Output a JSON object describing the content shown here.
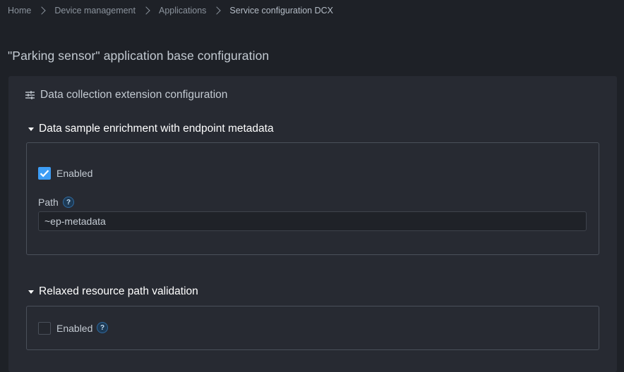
{
  "breadcrumb": {
    "items": [
      "Home",
      "Device management",
      "Applications",
      "Service configuration DCX"
    ]
  },
  "page": {
    "title": "\"Parking sensor\" application base configuration"
  },
  "panel": {
    "title": "Data collection extension configuration",
    "icon": "tune-icon",
    "sections": [
      {
        "title": "Data sample enrichment with endpoint metadata",
        "expanded": true,
        "enabled_label": "Enabled",
        "enabled": true,
        "path_label": "Path",
        "path_value": "~ep-metadata",
        "help_icon": "?"
      },
      {
        "title": "Relaxed resource path validation",
        "expanded": true,
        "enabled_label": "Enabled",
        "enabled": false,
        "help_icon": "?"
      }
    ]
  },
  "colors": {
    "background": "#1e2127",
    "panel": "#272a32",
    "accent": "#3d9df5",
    "border": "#4a505a",
    "text": "#c3cad2"
  }
}
